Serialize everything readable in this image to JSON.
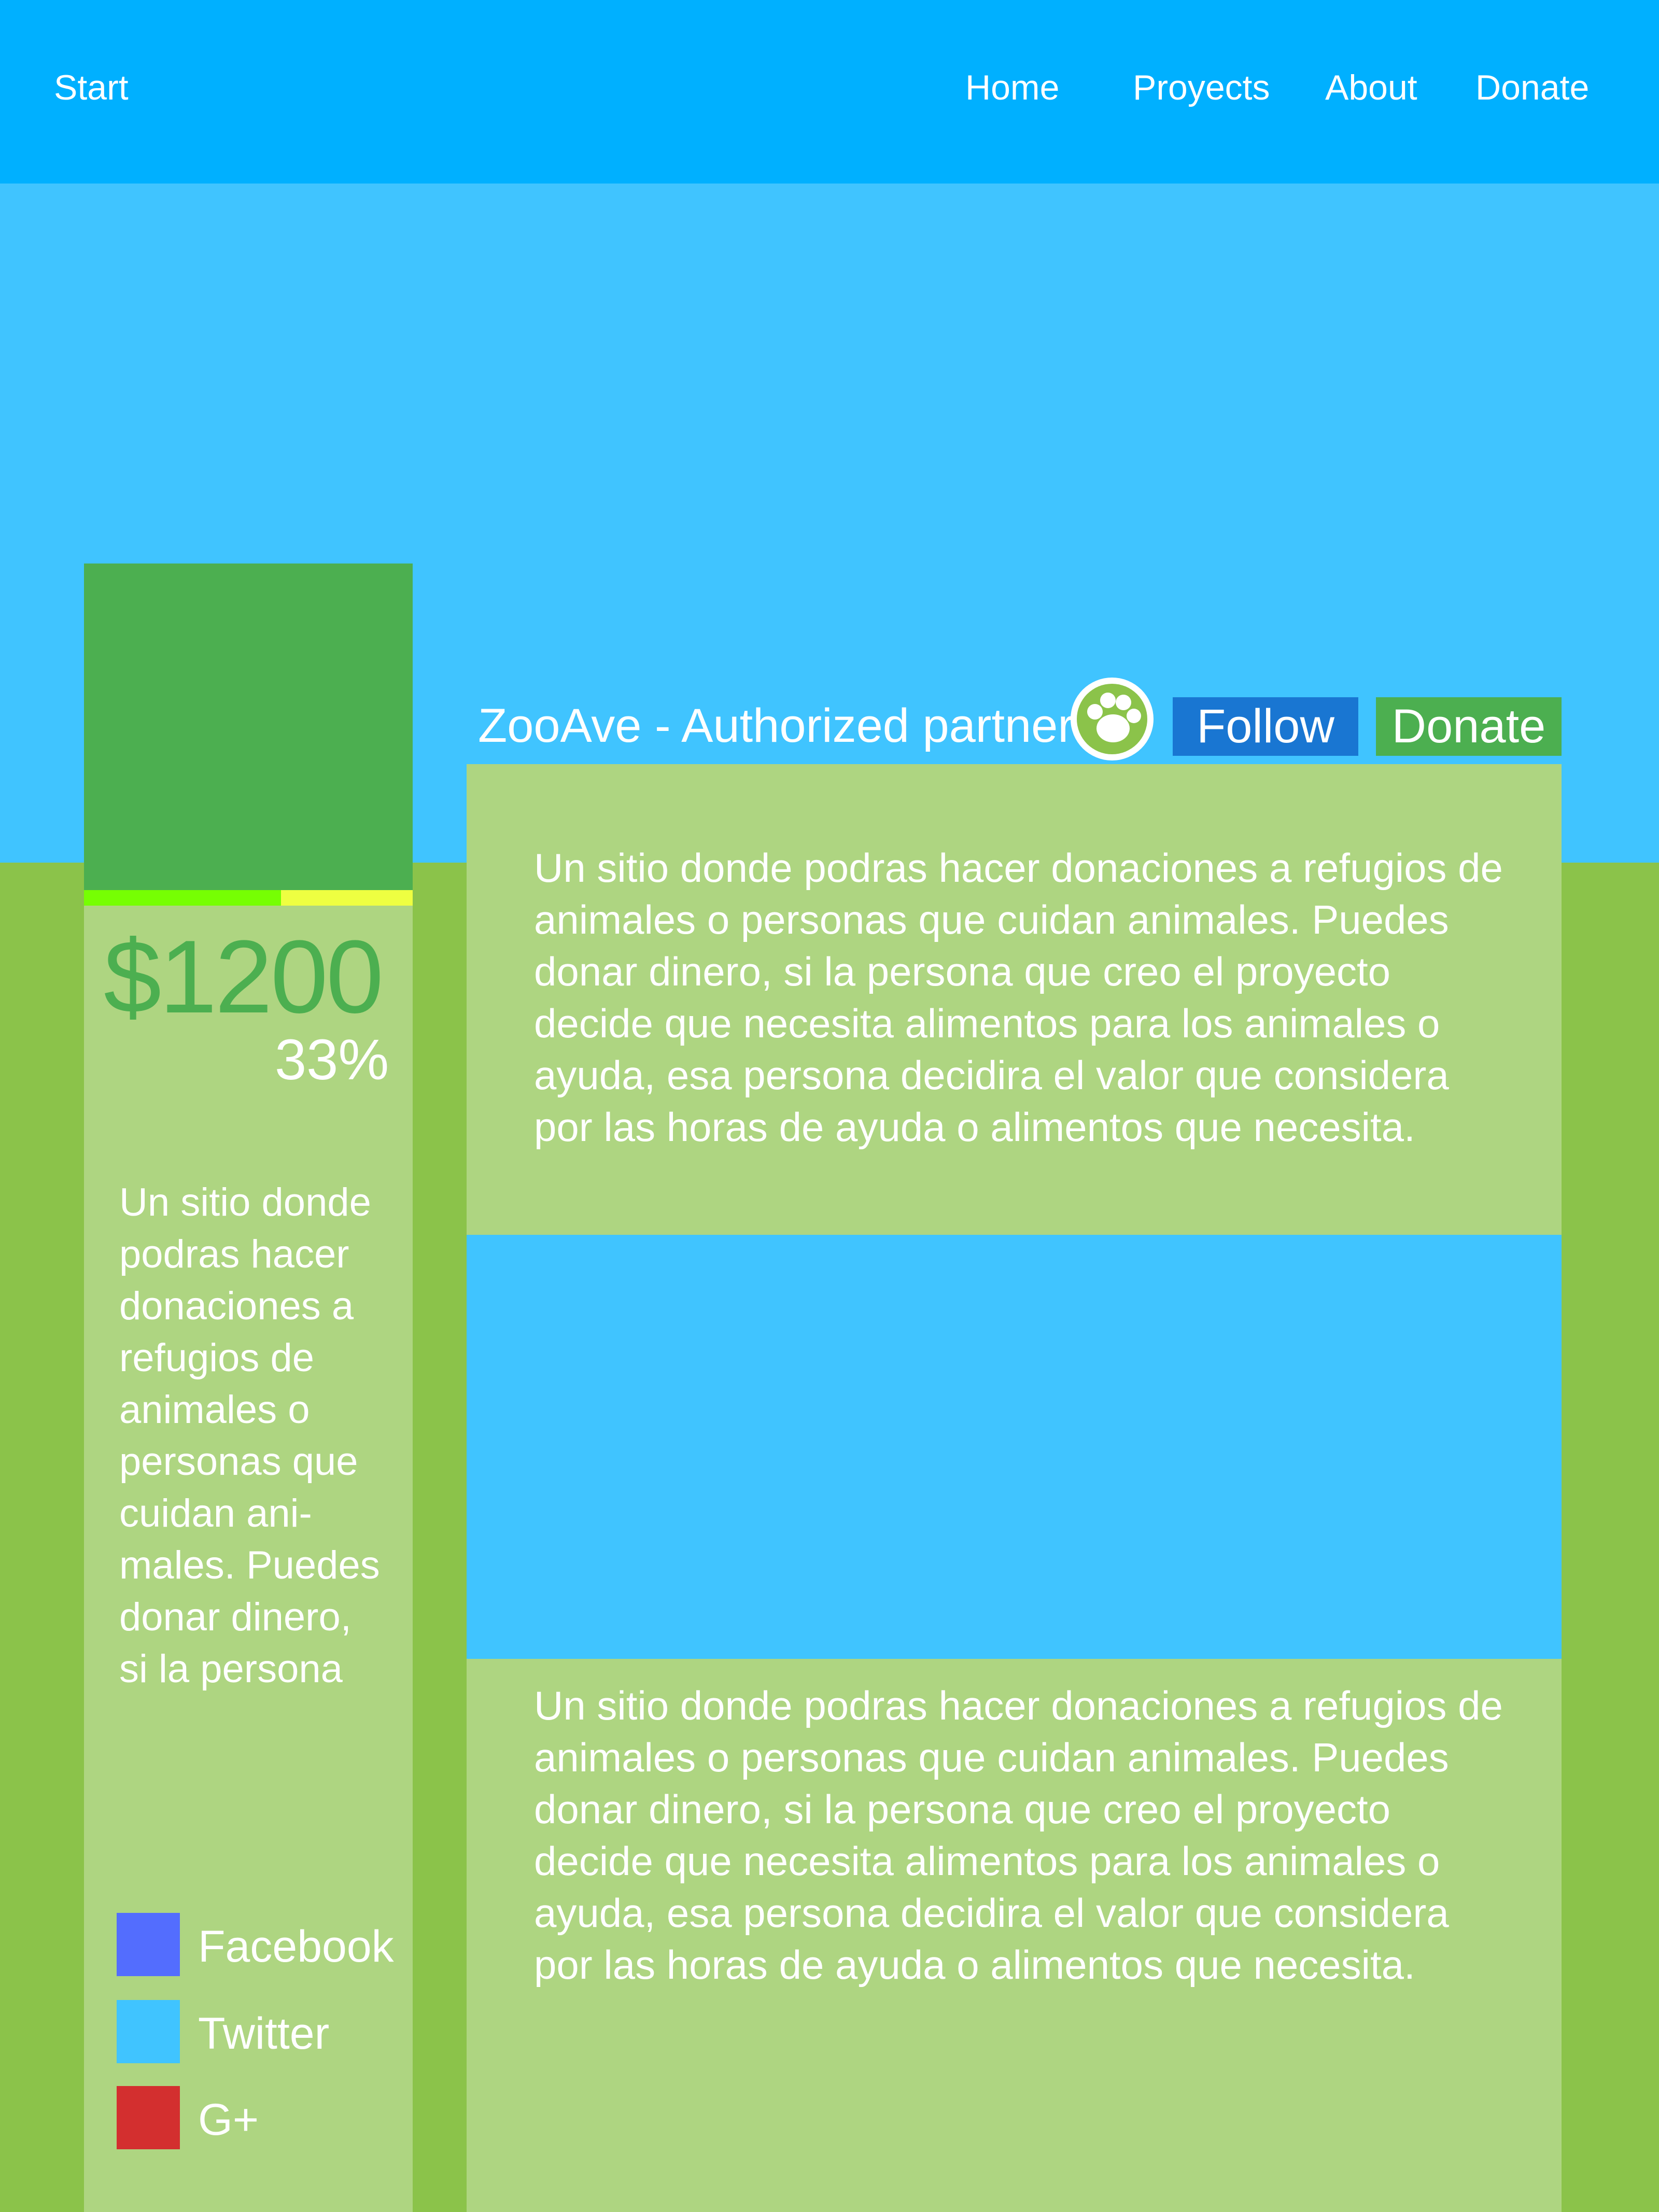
{
  "nav": {
    "start": "Start",
    "links": [
      "Home",
      "Proyects",
      "About",
      "Donate"
    ]
  },
  "campaign": {
    "amount": "$1200",
    "percent": "33%",
    "progress": 0.6,
    "description": "Un sitio donde podras hacer donaciones a refugios de animales o personas que cuidan ani-males. Puedes donar dinero, si la persona"
  },
  "partner": {
    "name": "ZooAve - Authorized partner",
    "follow_label": "Follow",
    "donate_label": "Donate",
    "badge_icon": "paw-icon"
  },
  "panels": [
    {
      "text": "Un sitio donde podras hacer donaciones a refugios de animales o personas que cuidan animales. Puedes donar dinero, si la persona que creo el proyecto decide que necesita alimentos para los animales o ayuda, esa persona decidira el valor que considera por las horas de ayuda o alimentos que necesita."
    },
    {
      "text": "Un sitio donde podras hacer donaciones a refugios de animales o personas que cuidan animales. Puedes donar dinero, si la persona que creo el proyecto decide que necesita alimentos para los animales o ayuda, esa persona decidira el valor que considera por las horas de ayuda o alimentos que necesita."
    }
  ],
  "social": [
    {
      "label": "Facebook",
      "color": "#536dfe"
    },
    {
      "label": "Twitter",
      "color": "#40c4ff"
    },
    {
      "label": "G+",
      "color": "#d32f2f"
    }
  ],
  "colors": {
    "topbar": "#00b0ff",
    "hero": "#40c4ff",
    "background": "#8bc34a",
    "card": "#aed581",
    "accent_green": "#4caf50",
    "follow_blue": "#1976d2",
    "progress_fill": "#76ff03",
    "progress_track": "#eeff41"
  }
}
